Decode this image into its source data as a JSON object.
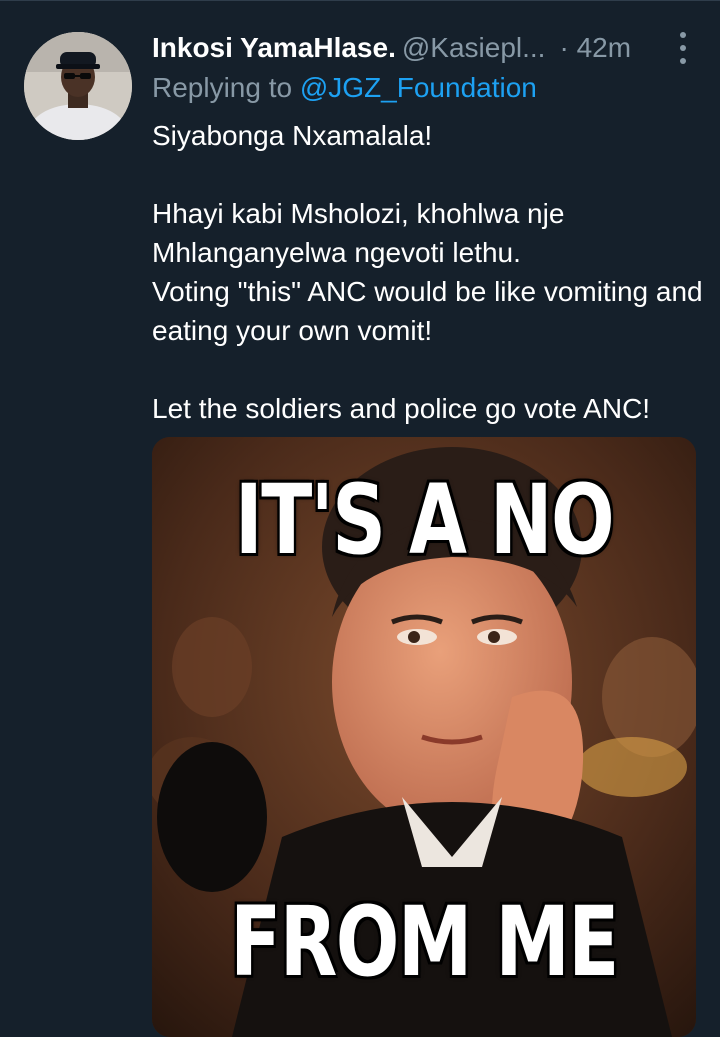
{
  "tweet": {
    "display_name": "Inkosi YamaHlase.",
    "handle": "@Kasiepl...",
    "separator": "·",
    "time": "42m",
    "replying_label": "Replying to",
    "replying_to": "@JGZ_Foundation",
    "text_lines": [
      "Siyabonga Nxamalala!",
      "Hhayi kabi Msholozi, khohlwa nje Mhlanganyelwa ngevoti lethu.",
      "Voting \"this\" ANC would be like vomiting and eating your own vomit!",
      "Let the soldiers and police go vote ANC!"
    ],
    "meme": {
      "top_text": "IT'S A NO",
      "bottom_text": "FROM ME"
    }
  },
  "colors": {
    "background": "#15202b",
    "secondary_text": "#8899a6",
    "link": "#1da1f2",
    "primary_text": "#ffffff"
  }
}
